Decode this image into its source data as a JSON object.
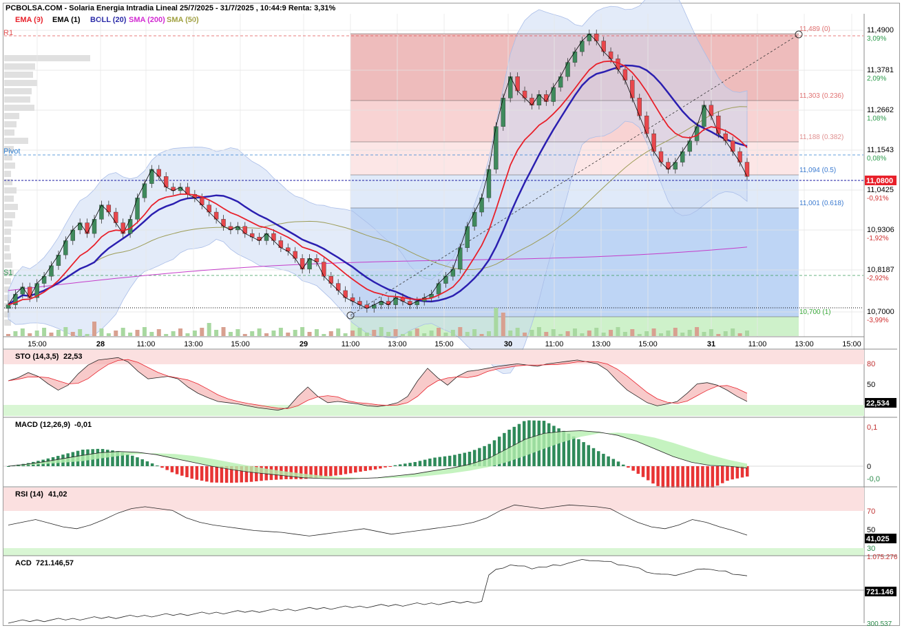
{
  "header": {
    "title": "PCBOLSA.COM - Solaria Energia Intradia Lineal 25/7/2025 - 31/7/2025 , 10:44:9 Renta: 3,31%"
  },
  "legend": [
    {
      "label": "EMA (9)",
      "color": "#e8202a"
    },
    {
      "label": "EMA (1)",
      "color": "#000000"
    },
    {
      "label": "BOLL (20)",
      "color": "#2a2aa8"
    },
    {
      "label": "SMA (200)",
      "color": "#d22ad2"
    },
    {
      "label": "SMA (50)",
      "color": "#a0a040"
    }
  ],
  "colors": {
    "up": "#3f8a5c",
    "down": "#e8474c",
    "ema9": "#e8202a",
    "boll": "#2b1fb0",
    "sma200": "#c43bc9",
    "sma50": "#9c9c56",
    "grid": "#d9d9d9"
  },
  "levels": {
    "r1": "R1",
    "pivot": "Pivot",
    "s1": "S1"
  },
  "chart_data": {
    "type": "line",
    "y_ticks": [
      "11,4900",
      "11,3781",
      "11,2662",
      "11,1543",
      "11,0425",
      "10,9306",
      "10,8187",
      "10,7000"
    ],
    "pct_ticks": [
      "3,09%",
      "2,09%",
      "1,08%",
      "0,08%",
      "-0,91%",
      "-1,92%",
      "-2,92%",
      "-3,99%"
    ],
    "current_price": "11,0800",
    "x_ticks": [
      "15:00",
      "28",
      "11:00",
      "13:00",
      "15:00",
      "29",
      "11:00",
      "13:00",
      "15:00",
      "30",
      "11:00",
      "13:00",
      "15:00",
      "31",
      "11:00",
      "13:00",
      "15:00"
    ],
    "fib_levels": [
      {
        "label": "11,489 (0)",
        "value": 11.489
      },
      {
        "label": "11,303 (0.236)",
        "value": 11.303
      },
      {
        "label": "11,188 (0.382)",
        "value": 11.188
      },
      {
        "label": "11,094 (0.5)",
        "value": 11.094
      },
      {
        "label": "11,001 (0.618)",
        "value": 11.001
      },
      {
        "label": "10,700 (1)",
        "value": 10.7
      }
    ],
    "price_series": [
      10.72,
      10.75,
      10.77,
      10.74,
      10.78,
      10.8,
      10.83,
      10.86,
      10.9,
      10.93,
      10.95,
      10.92,
      10.96,
      11.0,
      10.98,
      10.95,
      10.92,
      10.96,
      11.02,
      11.06,
      11.1,
      11.08,
      11.05,
      11.04,
      11.05,
      11.03,
      11.02,
      11.0,
      10.98,
      10.96,
      10.94,
      10.93,
      10.94,
      10.92,
      10.91,
      10.9,
      10.92,
      10.9,
      10.88,
      10.87,
      10.85,
      10.82,
      10.85,
      10.84,
      10.8,
      10.78,
      10.76,
      10.74,
      10.73,
      10.72,
      10.71,
      10.72,
      10.73,
      10.72,
      10.74,
      10.73,
      10.72,
      10.73,
      10.74,
      10.75,
      10.78,
      10.8,
      10.82,
      10.88,
      10.94,
      10.98,
      11.02,
      11.1,
      11.22,
      11.3,
      11.36,
      11.32,
      11.3,
      11.28,
      11.31,
      11.29,
      11.33,
      11.36,
      11.4,
      11.43,
      11.46,
      11.48,
      11.46,
      11.43,
      11.41,
      11.38,
      11.35,
      11.3,
      11.25,
      11.2,
      11.15,
      11.12,
      11.1,
      11.12,
      11.15,
      11.18,
      11.22,
      11.28,
      11.25,
      11.2,
      11.18,
      11.15,
      11.12,
      11.08
    ]
  },
  "panels": {
    "sto": {
      "label": "STO (14,3,5)",
      "value": "22,53",
      "current": "22,534",
      "ticks": [
        "80",
        "50"
      ],
      "k": [
        55,
        60,
        68,
        62,
        50,
        40,
        48,
        66,
        80,
        88,
        90,
        92,
        85,
        70,
        58,
        60,
        62,
        58,
        45,
        35,
        28,
        22,
        20,
        18,
        15,
        12,
        10,
        8,
        12,
        30,
        45,
        30,
        20,
        22,
        20,
        18,
        15,
        14,
        16,
        20,
        30,
        55,
        75,
        60,
        48,
        62,
        70,
        72,
        75,
        78,
        80,
        82,
        80,
        78,
        82,
        84,
        86,
        88,
        85,
        82,
        72,
        55,
        40,
        30,
        20,
        15,
        18,
        22,
        35,
        50,
        52,
        48,
        40,
        30,
        22
      ]
    },
    "macd": {
      "label": "MACD (12,26,9)",
      "value": "-0,01",
      "ticks": [
        "0,1",
        "0",
        "-0,0"
      ],
      "line": [
        0.0,
        0.005,
        0.012,
        0.02,
        0.028,
        0.035,
        0.038,
        0.036,
        0.03,
        0.02,
        0.01,
        0.0,
        -0.008,
        -0.015,
        -0.02,
        -0.025,
        -0.03,
        -0.032,
        -0.033,
        -0.032,
        -0.03,
        -0.025,
        -0.02,
        -0.012,
        -0.005,
        0.005,
        0.02,
        0.045,
        0.07,
        0.085,
        0.09,
        0.092,
        0.088,
        0.08,
        0.065,
        0.045,
        0.025,
        0.01,
        0.002,
        0.0,
        -0.005
      ]
    },
    "rsi": {
      "label": "RSI (14)",
      "value": "41,02",
      "current": "41,025",
      "ticks": [
        "70",
        "50",
        "30"
      ],
      "values": [
        52,
        55,
        58,
        54,
        50,
        48,
        52,
        58,
        65,
        70,
        72,
        70,
        68,
        60,
        55,
        52,
        50,
        48,
        46,
        45,
        44,
        42,
        40,
        42,
        44,
        46,
        48,
        45,
        42,
        44,
        46,
        48,
        50,
        52,
        55,
        60,
        68,
        74,
        72,
        70,
        72,
        74,
        73,
        72,
        70,
        62,
        55,
        50,
        48,
        52,
        58,
        55,
        50,
        46,
        41
      ]
    },
    "acd": {
      "label": "ACD",
      "value": "721.146,57",
      "current": "721.146",
      "ticks": [
        "1.075.276",
        "300.537"
      ]
    }
  }
}
